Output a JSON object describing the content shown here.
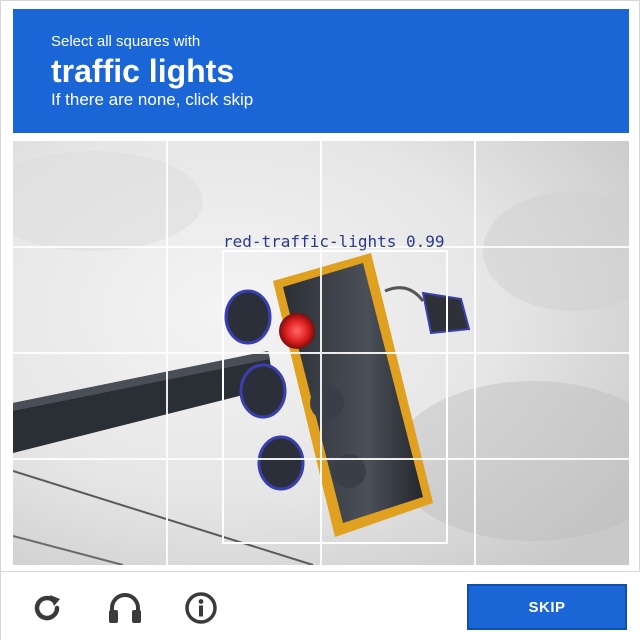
{
  "header": {
    "instruction_small": "Select all squares with",
    "target_object": "traffic lights",
    "hint": "If there are none, click skip"
  },
  "grid": {
    "tiles": [
      {
        "id": "r1c1"
      },
      {
        "id": "r1c2"
      },
      {
        "id": "r1c3"
      },
      {
        "id": "r1c4"
      },
      {
        "id": "r2c1"
      },
      {
        "id": "r2c2"
      },
      {
        "id": "r2c3"
      },
      {
        "id": "r2c4"
      },
      {
        "id": "r3c1"
      },
      {
        "id": "r3c2"
      },
      {
        "id": "r3c3"
      },
      {
        "id": "r3c4"
      },
      {
        "id": "r4c1"
      },
      {
        "id": "r4c2"
      },
      {
        "id": "r4c3"
      },
      {
        "id": "r4c4"
      }
    ],
    "detection_label": "red-traffic-lights 0.99"
  },
  "footer": {
    "reload_icon": "reload-icon",
    "audio_icon": "headphones-icon",
    "info_icon": "info-icon",
    "skip_label": "SKIP"
  },
  "colors": {
    "brand_blue": "#1a66d6",
    "detection_box": "#ffffff",
    "detection_text": "#2a3a8a"
  }
}
